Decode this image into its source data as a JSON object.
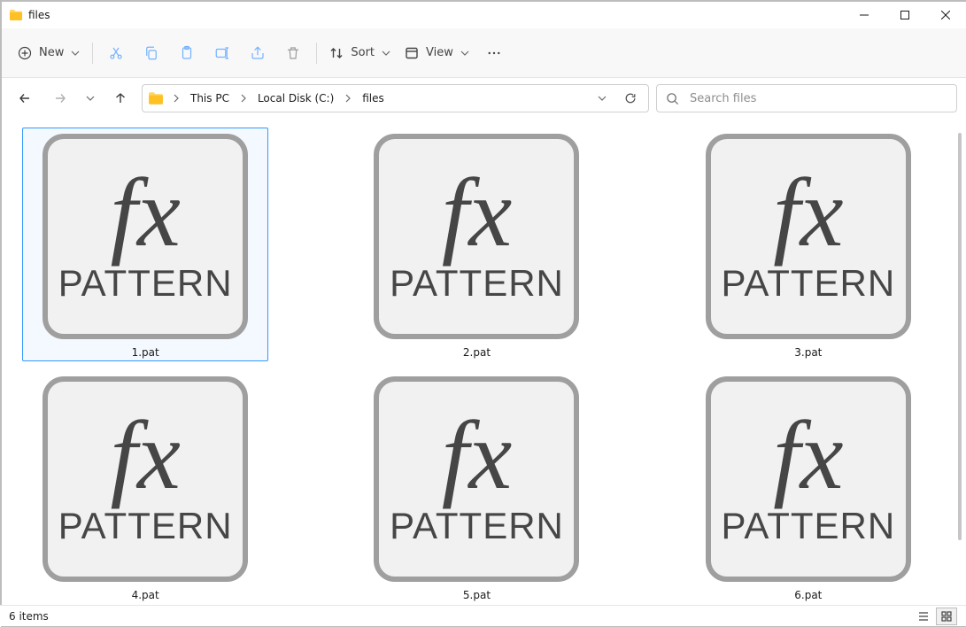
{
  "window": {
    "title": "files"
  },
  "toolbar": {
    "new_label": "New",
    "sort_label": "Sort",
    "view_label": "View"
  },
  "breadcrumbs": {
    "items": [
      "This PC",
      "Local Disk (C:)",
      "files"
    ]
  },
  "search": {
    "placeholder": "Search files"
  },
  "icon_art": {
    "fx": "fx",
    "pattern": "PATTERN"
  },
  "files": [
    {
      "name": "1.pat",
      "selected": true
    },
    {
      "name": "2.pat",
      "selected": false
    },
    {
      "name": "3.pat",
      "selected": false
    },
    {
      "name": "4.pat",
      "selected": false
    },
    {
      "name": "5.pat",
      "selected": false
    },
    {
      "name": "6.pat",
      "selected": false
    }
  ],
  "status": {
    "item_count_text": "6 items"
  }
}
